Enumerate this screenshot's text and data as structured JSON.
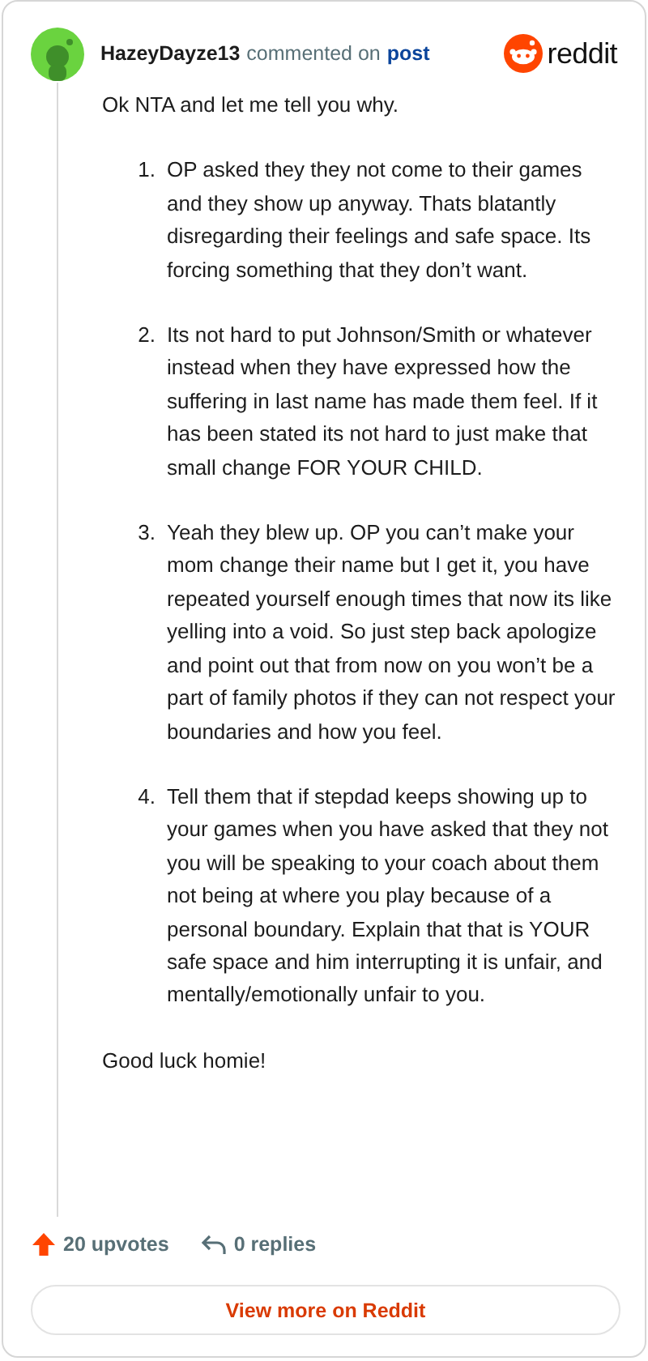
{
  "header": {
    "username": "HazeyDayze13",
    "action": "commented on",
    "target": "post",
    "logo_text": "reddit"
  },
  "comment": {
    "intro": "Ok NTA and let me tell you why.",
    "items": [
      {
        "number": "1.",
        "text": "OP asked they they not come to their games and they show up anyway. Thats blatantly disregarding their feelings and safe space. Its forcing something that they don’t want."
      },
      {
        "number": "2.",
        "text": "Its not hard to put Johnson/Smith or whatever instead when they have expressed how the suffering in last name has made them feel. If it has been stated its not hard to just make that small change FOR YOUR CHILD."
      },
      {
        "number": "3.",
        "text": "Yeah they blew up. OP you can’t make your mom change their name but I get it, you have repeated yourself enough times that now its like yelling into a void. So just step back apologize and point out that from now on you won’t be a part of family photos if they can not respect your boundaries and how you feel."
      },
      {
        "number": "4.",
        "text": "Tell them that if stepdad keeps showing up to your games when you have asked that they not you will be speaking to your coach about them not being at where you play because of a personal boundary. Explain that that is YOUR safe space and him interrupting it is unfair, and mentally/emotionally unfair to you."
      }
    ],
    "outro": "Good luck homie!"
  },
  "footer": {
    "upvotes": "20 upvotes",
    "replies": "0 replies",
    "button": "View more on Reddit"
  }
}
